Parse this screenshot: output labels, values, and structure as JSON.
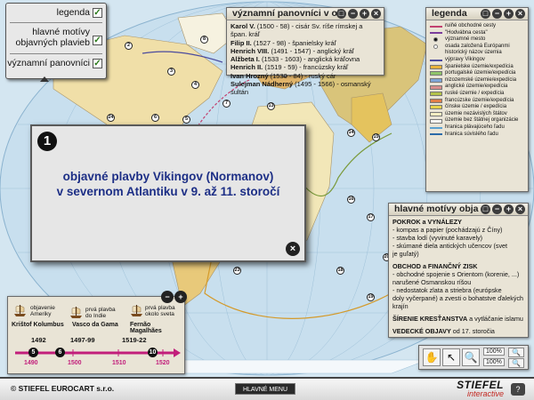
{
  "menu": {
    "items": [
      {
        "label": "legenda",
        "checked": "✓"
      },
      {
        "label": "hlavné motívy\nobjavných plavieb",
        "checked": "✓"
      },
      {
        "label": "významní panovníci",
        "checked": "✓"
      }
    ]
  },
  "rulers_panel": {
    "title": "významní panovníci v ob",
    "buttons": [
      "□",
      "−",
      "+",
      "×"
    ],
    "rows": [
      {
        "name": "Karol V.",
        "detail": "(1500 - 58) - cisár Sv. ríše rímskej a špan. kráľ"
      },
      {
        "name": "Filip II.",
        "detail": "(1527 - 98) - španielsky kráľ"
      },
      {
        "name": "Henrich VIII.",
        "detail": "(1491 - 1547) - anglický kráľ"
      },
      {
        "name": "Alžbeta I.",
        "detail": "(1533 - 1603) - anglická kráľovna"
      },
      {
        "name": "Henrich II.",
        "detail": "(1519 - 59) - francúzsky kráľ"
      },
      {
        "name": "Ivan Hrozný",
        "detail": "(1530 - 84) - ruský cár"
      },
      {
        "name": "Sulejman Nádherný",
        "detail": "(1495 - 1566) - osmanský sultán"
      }
    ]
  },
  "legend_panel": {
    "title": "legenda",
    "buttons": [
      "□",
      "−",
      "+",
      "×"
    ],
    "items": [
      {
        "label": "ruiňé obchodné cesty",
        "color": "#c2416f",
        "kind": "line"
      },
      {
        "label": "\"Hodvábna cesta\"",
        "color": "#7a3d9c",
        "kind": "line"
      },
      {
        "label": "významné mesto",
        "color": "#111111",
        "kind": "dot"
      },
      {
        "label": "osada založená Európanmi",
        "color": "#ffffff",
        "kind": "dot"
      },
      {
        "label": "historický názov územia",
        "color": "#777777",
        "kind": "text"
      },
      {
        "label": "výpravy Vikingov",
        "color": "#4b4b9e",
        "kind": "line"
      },
      {
        "label": "španielske územie/expedícia",
        "color": "#e8b23a",
        "kind": "swatch"
      },
      {
        "label": "portugalské územie/expedícia",
        "color": "#8fc46a",
        "kind": "swatch"
      },
      {
        "label": "nizozemské územie/expedícia",
        "color": "#7fa6d8",
        "kind": "swatch"
      },
      {
        "label": "anglické územie/expedícia",
        "color": "#d98e8e",
        "kind": "swatch"
      },
      {
        "label": "ruské územie / expedícia",
        "color": "#b3c24a",
        "kind": "swatch"
      },
      {
        "label": "francúzske územie/expedícia",
        "color": "#e07d48",
        "kind": "swatch"
      },
      {
        "label": "čínske územie / expedícia",
        "color": "#e6d24a",
        "kind": "swatch"
      },
      {
        "label": "územie nezávislých štátov",
        "color": "#f4edc2",
        "kind": "swatch"
      },
      {
        "label": "územie bez štátnej organizácie",
        "color": "#f8f8f3",
        "kind": "swatch"
      },
      {
        "label": "hranica plávajúceho ľadu",
        "color": "#5aa0d0",
        "kind": "line"
      },
      {
        "label": "hranica súvislého ľadu",
        "color": "#2a6aa8",
        "kind": "line"
      }
    ]
  },
  "motives_panel": {
    "title": "hlavné motívy obja",
    "buttons": [
      "□",
      "−",
      "+",
      "×"
    ],
    "sections": [
      {
        "heading": "POKROK a VYNÁLEZY",
        "lines": [
          "- kompas a papier (pochádzajú z Číny)",
          "- stavba lodí (vyvinuté karavely)",
          "- skúmané diela antických učencov (svet",
          "  je guľatý)"
        ]
      },
      {
        "heading": "OBCHOD a FINANČNÝ ZISK",
        "lines": [
          "- obchodné spojenie s Orientom (korenie, ...)",
          "  narušené Osmanskou ríšou",
          "- nedostatok zlata a striebra (európske",
          "  doly vyčerpané) a zvesti o bohatstve",
          "  ďalekých krajín"
        ]
      },
      {
        "heading": "ŠÍRENIE KRESŤANSTVA",
        "lines": [
          " a vytláčanie islamu"
        ]
      },
      {
        "heading": "VEDECKÉ OBJAVY",
        "lines": [
          " od 17. storočia"
        ]
      }
    ]
  },
  "dialog": {
    "number": "1",
    "text": "objavné plavby Vikingov (Normanov)\nv severnom Atlantiku v 9. až 11. storočí",
    "close": "×"
  },
  "timeline": {
    "explorers": [
      {
        "note": "objavenie\nAmeriky",
        "name": "Krištof Kolumbus"
      },
      {
        "note": "prvá plavba\ndo Indie",
        "name": "Vasco da Gama"
      },
      {
        "note": "prvá plavba\nokolo sveta",
        "name": "Fernão Magalhães"
      }
    ],
    "years": [
      "1492",
      "1497-99",
      "1519-22"
    ],
    "markers": [
      "5",
      "6",
      "10"
    ],
    "scale": [
      "1490",
      "1500",
      "1510",
      "1520"
    ],
    "controls": [
      "−",
      "+"
    ]
  },
  "tools": {
    "icons": [
      "hand-icon",
      "pointer-icon",
      "magnifier-icon",
      "zoom-in-icon",
      "zoom-out-icon"
    ],
    "zoom_a": "100%",
    "zoom_b": "100%"
  },
  "map": {
    "numbers": [
      "1",
      "2",
      "3",
      "4",
      "5",
      "6",
      "7",
      "8",
      "9",
      "10",
      "11",
      "12",
      "13",
      "14",
      "15",
      "16",
      "17",
      "18",
      "19",
      "20",
      "21",
      "22",
      "23",
      "24",
      "25"
    ]
  },
  "footer": {
    "company": "STIEFEL EUROCART s.r.o.",
    "main_menu": "HLAVNÉ MENU",
    "logo_main": "STIEFEL",
    "logo_sub": "interactive",
    "corner": "?"
  },
  "colors": {
    "ocean": "#cfe3ef",
    "land": "#f4edc2",
    "accent": "#c21e7b",
    "dialog_text": "#1d2f86"
  }
}
